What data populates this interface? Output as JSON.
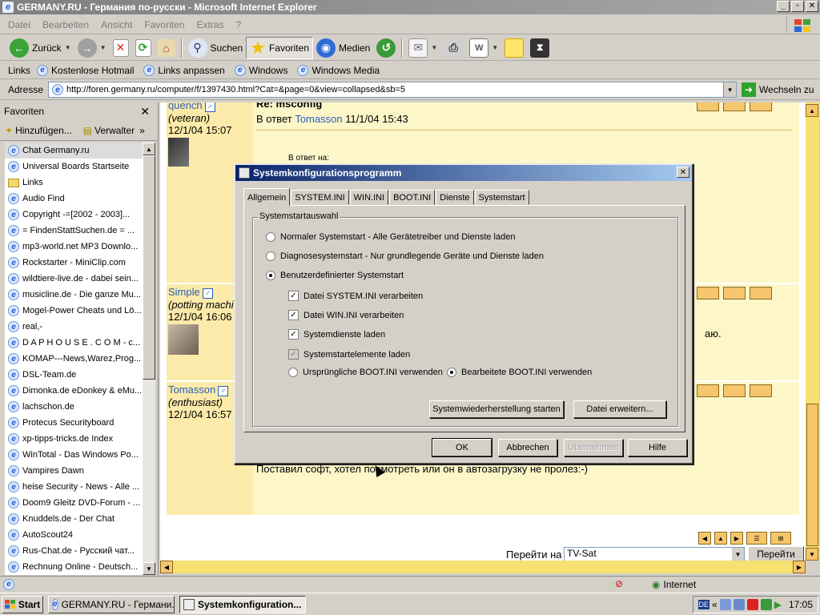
{
  "ie": {
    "title": "GERMANY.RU - Германия по-русски - Microsoft Internet Explorer",
    "menu": [
      "Datei",
      "Bearbeiten",
      "Ansicht",
      "Favoriten",
      "Extras",
      "?"
    ],
    "toolbar": {
      "back": "Zurück",
      "search": "Suchen",
      "favorites": "Favoriten",
      "media": "Medien"
    },
    "links_label": "Links",
    "links": [
      "Kostenlose Hotmail",
      "Links anpassen",
      "Windows",
      "Windows Media"
    ],
    "address_label": "Adresse",
    "address": "http://foren.germany.ru/computer/f/1397430.html?Cat=&page=0&view=collapsed&sb=5",
    "go_label": "Wechseln zu"
  },
  "favorites": {
    "title": "Favoriten",
    "add": "Hinzufügen...",
    "manage": "Verwalter",
    "items": [
      "Chat Germany.ru",
      "Universal Boards  Startseite",
      "Links",
      "Audio Find",
      "Copyright -=[2002 - 2003]...",
      "= FindenStattSuchen.de = ...",
      "mp3-world.net  MP3 Downlo...",
      "Rockstarter - MiniClip.com",
      "wildtiere-live.de - dabei sein...",
      "musicline.de - Die ganze Mu...",
      "Mogel-Power Cheats und Lö...",
      "real,-",
      "D A P H O U S E . C O M - c...",
      "KOMAP---News,Warez,Prog...",
      "DSL-Team.de",
      "Dimonka.de eDonkey & eMu...",
      "lachschon.de",
      "Protecus Securityboard",
      "xp-tipps-tricks.de  Index",
      "WinTotal - Das Windows Po...",
      "Vampires Dawn",
      "heise Security - News - Alle ...",
      "Doom9  Gleitz DVD-Forum - ...",
      "Knuddels.de - Der Chat",
      "AutoScout24",
      "Rus-Chat.de - Русский чат...",
      "Rechnung Online - Deutsch..."
    ]
  },
  "forum": {
    "posts": [
      {
        "user": "quench",
        "rank": "(veteran)",
        "date": "12/1/04 15:07",
        "subject": "Re: msconfig",
        "reply_to": "В ответ",
        "reply_user": "Tomasson",
        "reply_date": "11/1/04 15:43",
        "quote_head": "В ответ на:"
      },
      {
        "user": "Simple",
        "rank": "(potting machi",
        "date": "12/1/04 16:06",
        "tail": "аю."
      },
      {
        "user": "Tomasson",
        "rank": "(enthusiast)",
        "date": "12/1/04 16:57",
        "body": "Поставил софт, хотел посмотреть или он в автозагрузку не пролез:-)"
      }
    ],
    "goto_label": "Перейти на",
    "goto_value": "TV-Sat",
    "goto_button": "Перейти"
  },
  "status": {
    "zone": "Internet"
  },
  "taskbar": {
    "start": "Start",
    "tasks": [
      "GERMANY.RU - Германи...",
      "Systemkonfiguration..."
    ],
    "lang": "DE",
    "clock": "17:05"
  },
  "dialog": {
    "title": "Systemkonfigurationsprogramm",
    "tabs": [
      "Allgemein",
      "SYSTEM.INI",
      "WIN.INI",
      "BOOT.INI",
      "Dienste",
      "Systemstart"
    ],
    "group_label": "Systemstartauswahl",
    "radio_normal": "Normaler Systemstart - Alle Gerätetreiber und Dienste laden",
    "radio_diag": "Diagnosesystemstart - Nur grundlegende Geräte und Dienste laden",
    "radio_custom": "Benutzerdefinierter Systemstart",
    "chk_system_ini": "Datei SYSTEM.INI verarbeiten",
    "chk_win_ini": "Datei WIN.INI verarbeiten",
    "chk_services": "Systemdienste laden",
    "chk_startup": "Systemstartelemente laden",
    "radio_boot_orig": "Ursprüngliche BOOT.INI verwenden",
    "radio_boot_mod": "Bearbeitete BOOT.INI verwenden",
    "btn_restore": "Systemwiederherstellung starten",
    "btn_expand": "Datei erweitern...",
    "btn_ok": "OK",
    "btn_cancel": "Abbrechen",
    "btn_apply": "Übernehmen",
    "btn_help": "Hilfe"
  }
}
